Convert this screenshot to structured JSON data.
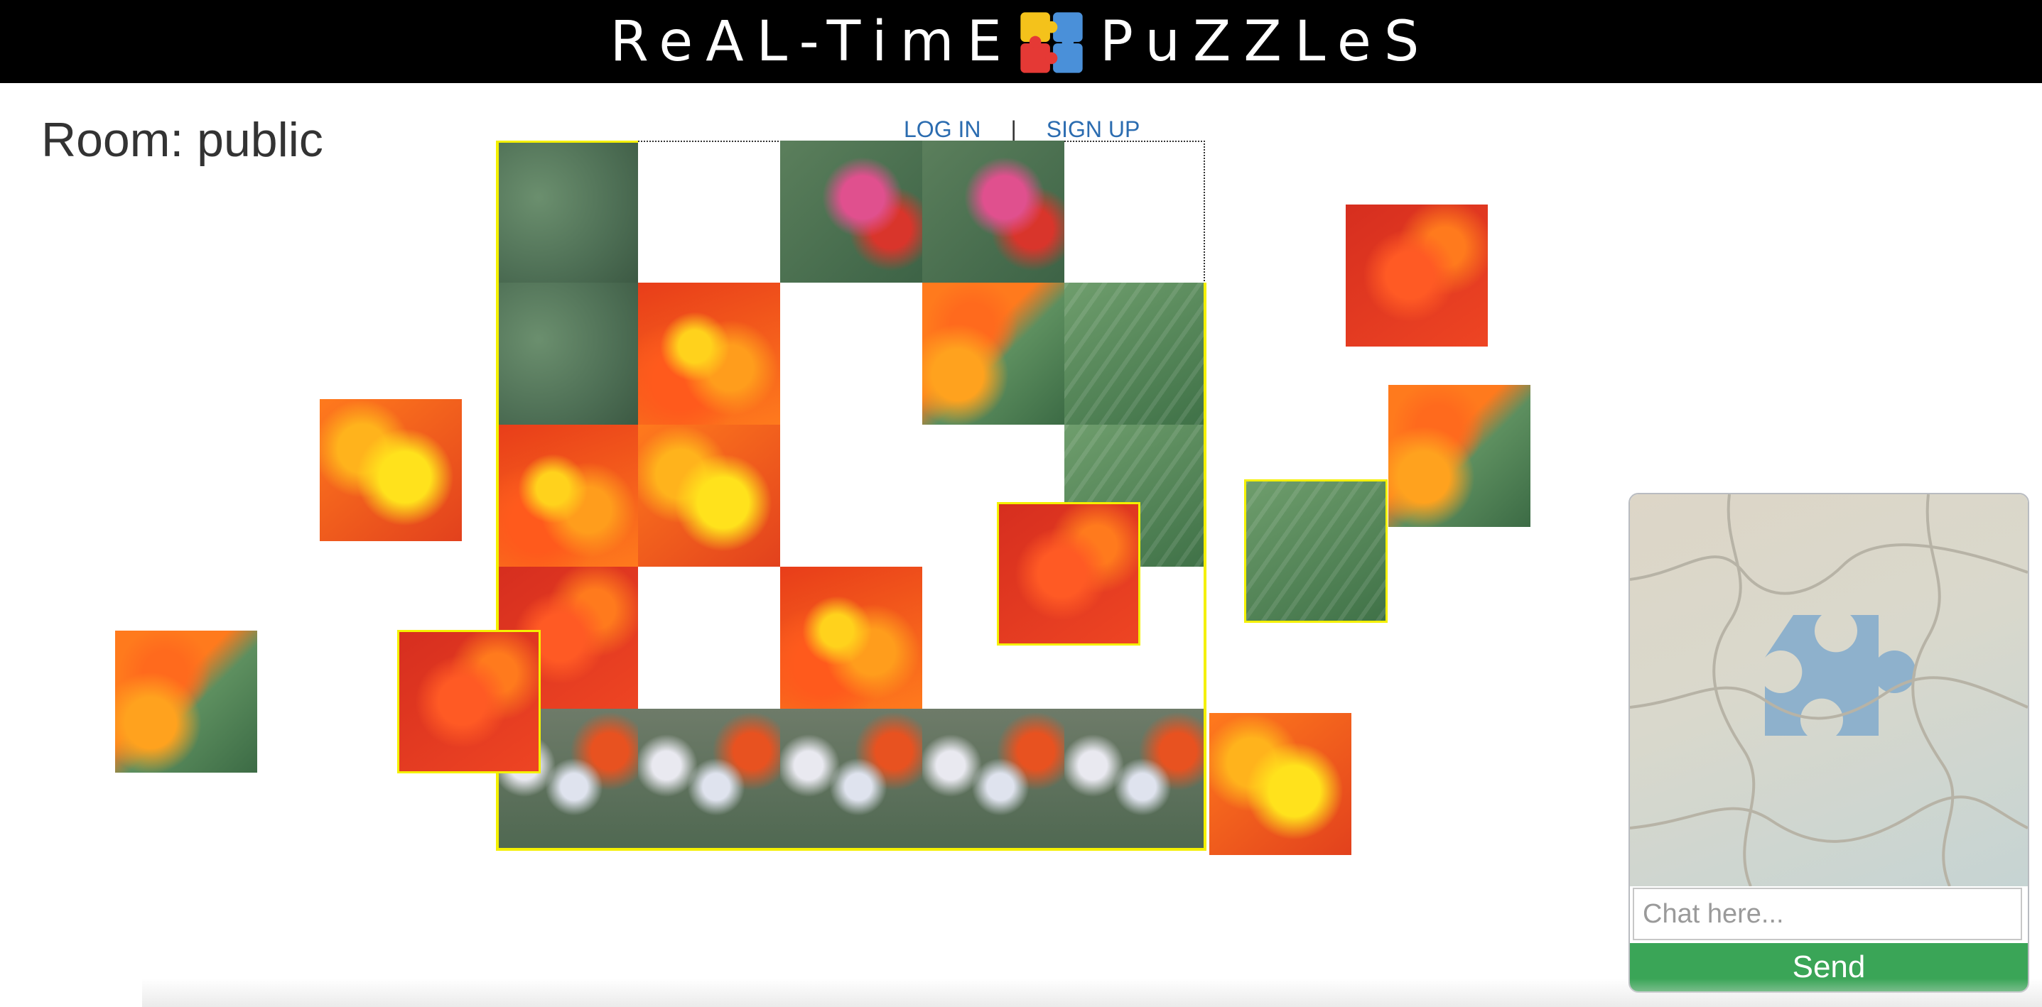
{
  "header": {
    "title_left": "ReAL-TimE",
    "title_right": "PuZZLeS",
    "logo_icon": "puzzle-pieces-icon"
  },
  "room": {
    "label": "Room: public"
  },
  "auth": {
    "login": "LOG IN",
    "separator": "|",
    "signup": "SIGN UP"
  },
  "chat": {
    "placeholder": "Chat here...",
    "send_label": "Send",
    "art_icon": "jigsaw-puzzle-illustration"
  },
  "colors": {
    "header_bg": "#000000",
    "highlight": "#f4f000",
    "send_button": "#3aa557",
    "link": "#2b6cb0"
  }
}
